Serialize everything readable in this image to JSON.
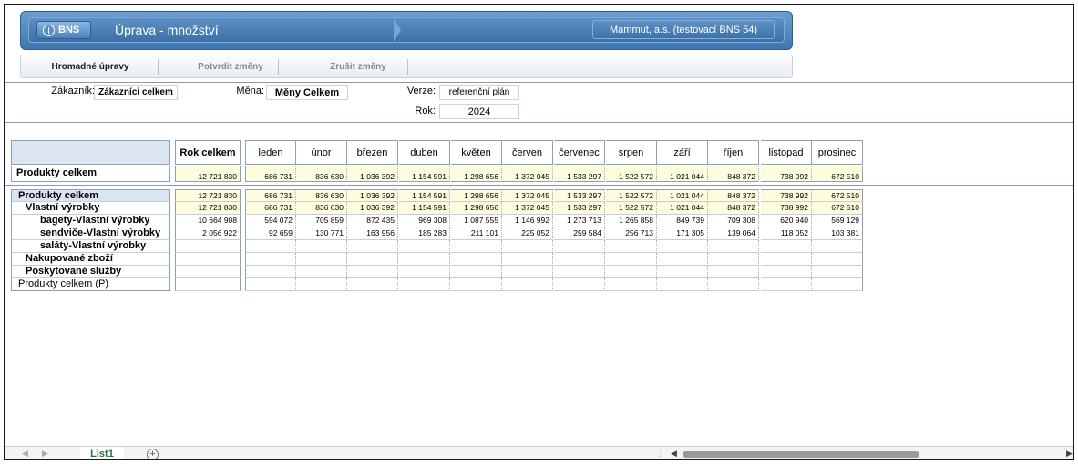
{
  "header": {
    "app_button": "BNS",
    "title": "Úprava - množství",
    "company": "Mammut, a.s. (testovací BNS 54)"
  },
  "toolbar": {
    "bulk_edit": "Hromadné úpravy",
    "confirm": "Potvrdit změny",
    "cancel": "Zrušit změny"
  },
  "filters": {
    "customer_label": "Zákazník:",
    "customer_value": "Zákazníci celkem",
    "currency_label": "Měna:",
    "currency_value": "Měny Celkem",
    "version_label": "Verze:",
    "version_value": "referenční plán",
    "year_label": "Rok:",
    "year_value": "2024"
  },
  "grid": {
    "year_total_header": "Rok celkem",
    "months": [
      "leden",
      "únor",
      "březen",
      "duben",
      "květen",
      "červen",
      "červenec",
      "srpen",
      "září",
      "říjen",
      "listopad",
      "prosinec"
    ],
    "summary": {
      "label": "Produkty celkem",
      "total": "12 721 830",
      "values": [
        "686 731",
        "836 630",
        "1 036 392",
        "1 154 591",
        "1 298 656",
        "1 372 045",
        "1 533 297",
        "1 522 572",
        "1 021 044",
        "848 372",
        "738 992",
        "672 510"
      ]
    },
    "rows": [
      {
        "label": "Produkty celkem",
        "total": "12 721 830",
        "values": [
          "686 731",
          "836 630",
          "1 036 392",
          "1 154 591",
          "1 298 656",
          "1 372 045",
          "1 533 297",
          "1 522 572",
          "1 021 044",
          "848 372",
          "738 992",
          "672 510"
        ]
      },
      {
        "label": "Vlastní výrobky",
        "total": "12 721 830",
        "values": [
          "686 731",
          "836 630",
          "1 036 392",
          "1 154 591",
          "1 298 656",
          "1 372 045",
          "1 533 297",
          "1 522 572",
          "1 021 044",
          "848 372",
          "738 992",
          "672 510"
        ]
      },
      {
        "label": "bagety-Vlastní výrobky",
        "total": "10 664 908",
        "values": [
          "594 072",
          "705 859",
          "872 435",
          "969 308",
          "1 087 555",
          "1 146 992",
          "1 273 713",
          "1 265 858",
          "849 739",
          "709 308",
          "620 940",
          "569 129"
        ]
      },
      {
        "label": "sendviče-Vlastní výrobky",
        "total": "2 056 922",
        "values": [
          "92 659",
          "130 771",
          "163 956",
          "185 283",
          "211 101",
          "225 052",
          "259 584",
          "256 713",
          "171 305",
          "139 064",
          "118 052",
          "103 381"
        ]
      },
      {
        "label": "saláty-Vlastní výrobky",
        "total": "",
        "values": [
          "",
          "",
          "",
          "",
          "",
          "",
          "",
          "",
          "",
          "",
          "",
          ""
        ]
      },
      {
        "label": "Nakupované zboží",
        "total": "",
        "values": [
          "",
          "",
          "",
          "",
          "",
          "",
          "",
          "",
          "",
          "",
          "",
          ""
        ]
      },
      {
        "label": "Poskytované služby",
        "total": "",
        "values": [
          "",
          "",
          "",
          "",
          "",
          "",
          "",
          "",
          "",
          "",
          "",
          ""
        ]
      },
      {
        "label": "Produkty celkem (P)",
        "total": "",
        "values": [
          "",
          "",
          "",
          "",
          "",
          "",
          "",
          "",
          "",
          "",
          "",
          ""
        ]
      }
    ]
  },
  "sheet": {
    "tab": "List1",
    "add": "+"
  },
  "colors": {
    "banner": "#3f76ad",
    "highlight": "#fdfcdc",
    "header_fill": "#dbe5f1",
    "sheet_tab": "#217346"
  }
}
